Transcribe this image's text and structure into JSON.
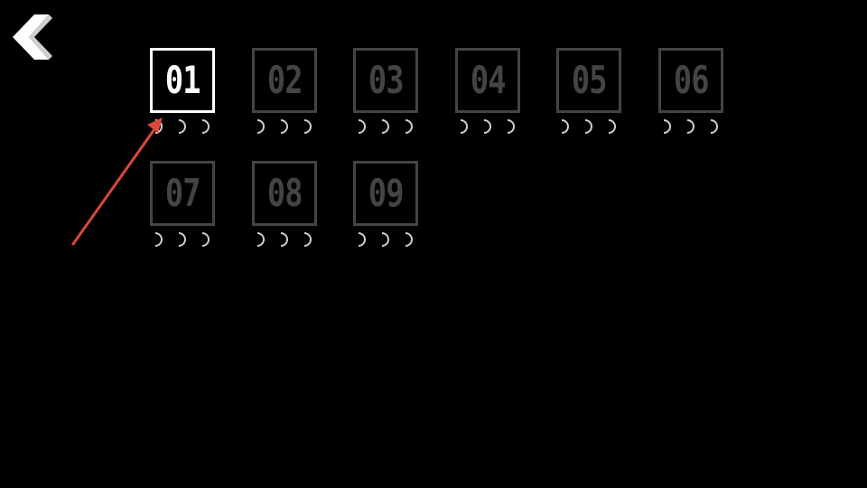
{
  "colors": {
    "background": "#000000",
    "selected": "#ffffff",
    "locked": "#444444",
    "arrow": "#d9483b"
  },
  "back_button": {
    "icon": "chevron-left-icon"
  },
  "hint": {
    "icon": "arrow-icon"
  },
  "levels": [
    {
      "label": "01",
      "selected": true,
      "moons": 3
    },
    {
      "label": "02",
      "selected": false,
      "moons": 3
    },
    {
      "label": "03",
      "selected": false,
      "moons": 3
    },
    {
      "label": "04",
      "selected": false,
      "moons": 3
    },
    {
      "label": "05",
      "selected": false,
      "moons": 3
    },
    {
      "label": "06",
      "selected": false,
      "moons": 3
    },
    {
      "label": "07",
      "selected": false,
      "moons": 3
    },
    {
      "label": "08",
      "selected": false,
      "moons": 3
    },
    {
      "label": "09",
      "selected": false,
      "moons": 3
    }
  ]
}
